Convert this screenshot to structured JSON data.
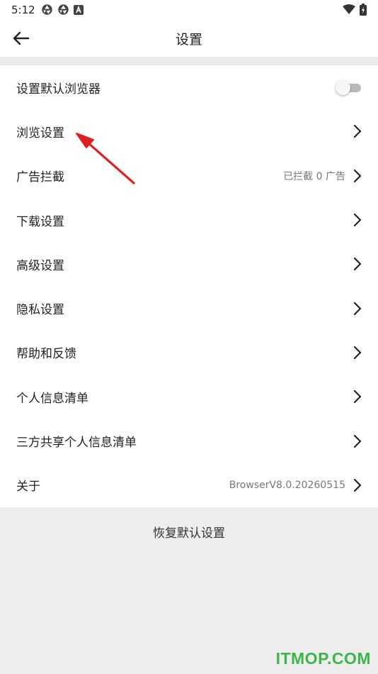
{
  "status_bar": {
    "time": "5:12",
    "icons": [
      "aperture-icon",
      "aperture-icon",
      "a-box-icon",
      "wifi-icon",
      "battery-icon"
    ]
  },
  "header": {
    "title": "设置",
    "back_icon": "back-arrow-icon"
  },
  "settings": {
    "items": [
      {
        "label": "设置默认浏览器",
        "control": "toggle",
        "toggle_on": false
      },
      {
        "label": "浏览设置",
        "control": "chevron"
      },
      {
        "label": "广告拦截",
        "detail": "已拦截 0 广告",
        "control": "chevron"
      },
      {
        "label": "下载设置",
        "control": "chevron"
      },
      {
        "label": "高级设置",
        "control": "chevron"
      },
      {
        "label": "隐私设置",
        "control": "chevron"
      },
      {
        "label": "帮助和反馈",
        "control": "chevron"
      },
      {
        "label": "个人信息清单",
        "control": "chevron"
      },
      {
        "label": "三方共享个人信息清单",
        "control": "chevron"
      },
      {
        "label": "关于",
        "detail": "BrowserV8.0.20260515",
        "control": "chevron"
      }
    ]
  },
  "reset_button": {
    "label": "恢复默认设置"
  },
  "watermark": {
    "text": "ITMOP.COM"
  },
  "colors": {
    "annotation_arrow": "#e02020",
    "watermark": "#3db54a",
    "background": "#ededed"
  }
}
